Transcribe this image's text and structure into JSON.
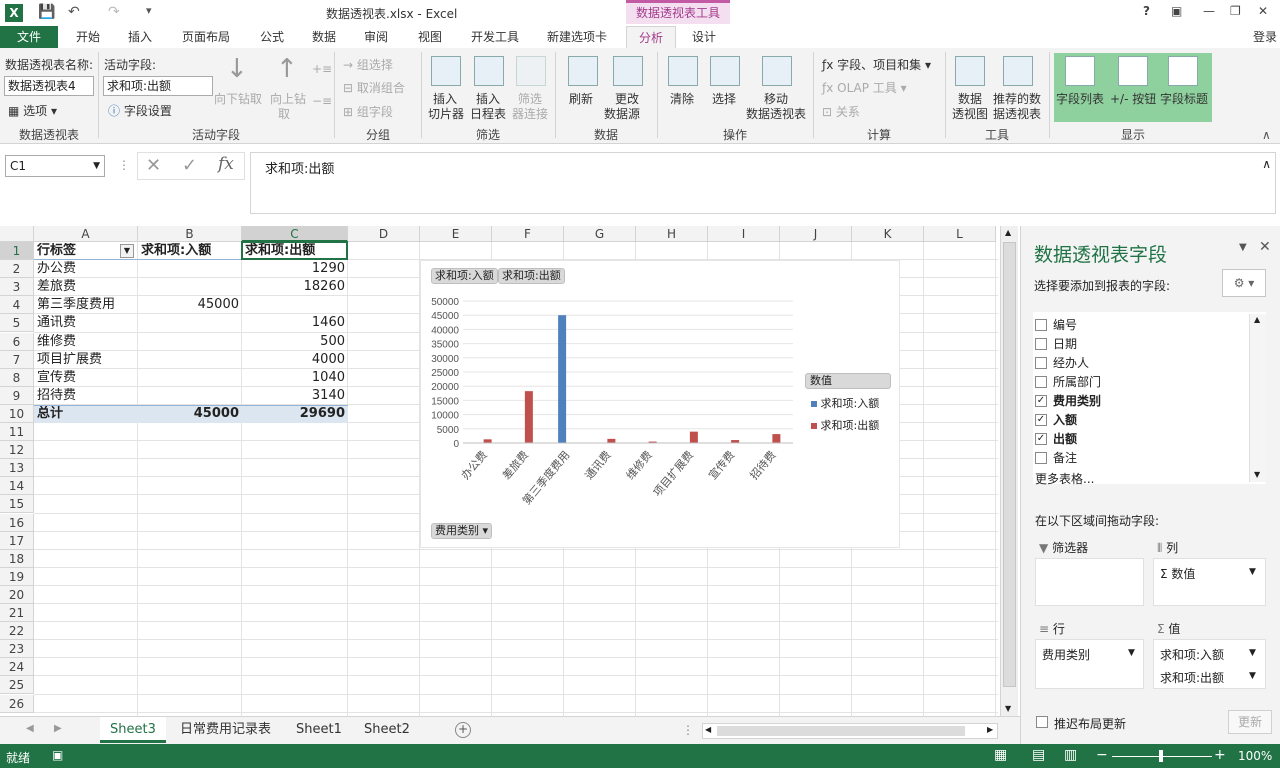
{
  "app": {
    "title": "数据透视表.xlsx - Excel",
    "tool_tab": "数据透视表工具",
    "signin": "登录",
    "help": "?"
  },
  "tabs": [
    "文件",
    "开始",
    "插入",
    "页面布局",
    "公式",
    "数据",
    "审阅",
    "视图",
    "开发工具",
    "新建选项卡",
    "分析",
    "设计"
  ],
  "ribbon": {
    "pt_name_label": "数据透视表名称:",
    "pt_name": "数据透视表4",
    "options": "选项",
    "pt_group": "数据透视表",
    "active_field_label": "活动字段:",
    "active_field": "求和项:出额",
    "field_settings": "字段设置",
    "drill_down": "向下钻取",
    "drill_up1": "向上钻",
    "drill_up2": "取",
    "active_group": "活动字段",
    "group_selection": "组选择",
    "ungroup": "取消组合",
    "group_field": "组字段",
    "group_group": "分组",
    "slicer1": "插入",
    "slicer2": "切片器",
    "timeline1": "插入",
    "timeline2": "日程表",
    "filter_conn1": "筛选",
    "filter_conn2": "器连接",
    "filter_group": "筛选",
    "refresh": "刷新",
    "change_src1": "更改",
    "change_src2": "数据源",
    "data_group": "数据",
    "clear": "清除",
    "select": "选择",
    "move1": "移动",
    "move2": "数据透视表",
    "ops_group": "操作",
    "fields_items": "字段、项目和集",
    "olap": "OLAP 工具",
    "relations": "关系",
    "calc_group": "计算",
    "pivot_chart1": "数据",
    "pivot_chart2": "透视图",
    "recommend1": "推荐的数",
    "recommend2": "据透视表",
    "tools_group": "工具",
    "field_list": "字段列表",
    "plus_minus": "+/- 按钮",
    "field_headers": "字段标题",
    "show_group": "显示"
  },
  "formula_bar": {
    "name_box": "C1",
    "fx": "fx",
    "content": "求和项:出额"
  },
  "columns": [
    "A",
    "B",
    "C",
    "D",
    "E",
    "F",
    "G",
    "H",
    "I",
    "J",
    "K",
    "L"
  ],
  "rows": [
    "1",
    "2",
    "3",
    "4",
    "5",
    "6",
    "7",
    "8",
    "9",
    "10",
    "11",
    "12",
    "13",
    "14",
    "15",
    "16",
    "17",
    "18",
    "19",
    "20",
    "21",
    "22",
    "23",
    "24",
    "25",
    "26"
  ],
  "pivot": {
    "headers": [
      "行标签",
      "求和项:入额",
      "求和项:出额"
    ],
    "data": [
      {
        "label": "办公费",
        "in": "",
        "out": "1290"
      },
      {
        "label": "差旅费",
        "in": "",
        "out": "18260"
      },
      {
        "label": "第三季度费用",
        "in": "45000",
        "out": ""
      },
      {
        "label": "通讯费",
        "in": "",
        "out": "1460"
      },
      {
        "label": "维修费",
        "in": "",
        "out": "500"
      },
      {
        "label": "项目扩展费",
        "in": "",
        "out": "4000"
      },
      {
        "label": "宣传费",
        "in": "",
        "out": "1040"
      },
      {
        "label": "招待费",
        "in": "",
        "out": "3140"
      }
    ],
    "total": {
      "label": "总计",
      "in": "45000",
      "out": "29690"
    }
  },
  "chart_btns": {
    "in": "求和项:入额",
    "out": "求和项:出额",
    "category": "费用类别"
  },
  "chart_data": {
    "type": "bar",
    "categories": [
      "办公费",
      "差旅费",
      "第三季度费用",
      "通讯费",
      "维修费",
      "项目扩展费",
      "宣传费",
      "招待费"
    ],
    "series": [
      {
        "name": "求和项:入额",
        "values": [
          0,
          0,
          45000,
          0,
          0,
          0,
          0,
          0
        ],
        "color": "#4f81bd"
      },
      {
        "name": "求和项:出额",
        "values": [
          1290,
          18260,
          0,
          1460,
          500,
          4000,
          1040,
          3140
        ],
        "color": "#c0504d"
      }
    ],
    "ylim": [
      0,
      50000
    ],
    "yticks": [
      "50000",
      "45000",
      "40000",
      "35000",
      "30000",
      "25000",
      "20000",
      "15000",
      "10000",
      "5000",
      "0"
    ],
    "legend_title": "数值",
    "legend": "right"
  },
  "sheets": [
    "Sheet3",
    "日常费用记录表",
    "Sheet1",
    "Sheet2"
  ],
  "status": {
    "ready": "就绪",
    "zoom": "100%"
  },
  "panel": {
    "title": "数据透视表字段",
    "subtitle": "选择要添加到报表的字段:",
    "fields": [
      {
        "name": "编号",
        "checked": false
      },
      {
        "name": "日期",
        "checked": false
      },
      {
        "name": "经办人",
        "checked": false
      },
      {
        "name": "所属部门",
        "checked": false
      },
      {
        "name": "费用类别",
        "checked": true
      },
      {
        "name": "入额",
        "checked": true
      },
      {
        "name": "出额",
        "checked": true
      },
      {
        "name": "备注",
        "checked": false
      }
    ],
    "more_tables": "更多表格...",
    "drag_hint": "在以下区域间拖动字段:",
    "filters": "筛选器",
    "columns": "列",
    "rows": "行",
    "values": "值",
    "col_item": "数值",
    "row_item": "费用类别",
    "val_item1": "求和项:入额",
    "val_item2": "求和项:出额",
    "defer": "推迟布局更新",
    "update": "更新"
  }
}
